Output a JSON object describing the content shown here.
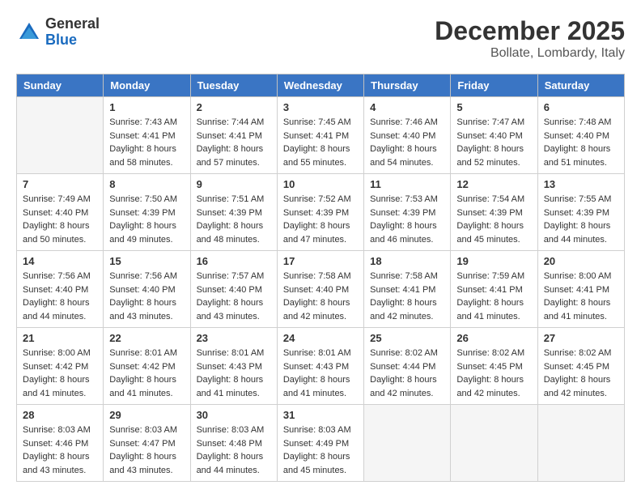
{
  "logo": {
    "general": "General",
    "blue": "Blue"
  },
  "title": "December 2025",
  "location": "Bollate, Lombardy, Italy",
  "weekdays": [
    "Sunday",
    "Monday",
    "Tuesday",
    "Wednesday",
    "Thursday",
    "Friday",
    "Saturday"
  ],
  "days": [
    {
      "date": null,
      "number": "",
      "sunrise": "",
      "sunset": "",
      "daylight": ""
    },
    {
      "date": 1,
      "number": "1",
      "sunrise": "Sunrise: 7:43 AM",
      "sunset": "Sunset: 4:41 PM",
      "daylight": "Daylight: 8 hours and 58 minutes."
    },
    {
      "date": 2,
      "number": "2",
      "sunrise": "Sunrise: 7:44 AM",
      "sunset": "Sunset: 4:41 PM",
      "daylight": "Daylight: 8 hours and 57 minutes."
    },
    {
      "date": 3,
      "number": "3",
      "sunrise": "Sunrise: 7:45 AM",
      "sunset": "Sunset: 4:41 PM",
      "daylight": "Daylight: 8 hours and 55 minutes."
    },
    {
      "date": 4,
      "number": "4",
      "sunrise": "Sunrise: 7:46 AM",
      "sunset": "Sunset: 4:40 PM",
      "daylight": "Daylight: 8 hours and 54 minutes."
    },
    {
      "date": 5,
      "number": "5",
      "sunrise": "Sunrise: 7:47 AM",
      "sunset": "Sunset: 4:40 PM",
      "daylight": "Daylight: 8 hours and 52 minutes."
    },
    {
      "date": 6,
      "number": "6",
      "sunrise": "Sunrise: 7:48 AM",
      "sunset": "Sunset: 4:40 PM",
      "daylight": "Daylight: 8 hours and 51 minutes."
    },
    {
      "date": 7,
      "number": "7",
      "sunrise": "Sunrise: 7:49 AM",
      "sunset": "Sunset: 4:40 PM",
      "daylight": "Daylight: 8 hours and 50 minutes."
    },
    {
      "date": 8,
      "number": "8",
      "sunrise": "Sunrise: 7:50 AM",
      "sunset": "Sunset: 4:39 PM",
      "daylight": "Daylight: 8 hours and 49 minutes."
    },
    {
      "date": 9,
      "number": "9",
      "sunrise": "Sunrise: 7:51 AM",
      "sunset": "Sunset: 4:39 PM",
      "daylight": "Daylight: 8 hours and 48 minutes."
    },
    {
      "date": 10,
      "number": "10",
      "sunrise": "Sunrise: 7:52 AM",
      "sunset": "Sunset: 4:39 PM",
      "daylight": "Daylight: 8 hours and 47 minutes."
    },
    {
      "date": 11,
      "number": "11",
      "sunrise": "Sunrise: 7:53 AM",
      "sunset": "Sunset: 4:39 PM",
      "daylight": "Daylight: 8 hours and 46 minutes."
    },
    {
      "date": 12,
      "number": "12",
      "sunrise": "Sunrise: 7:54 AM",
      "sunset": "Sunset: 4:39 PM",
      "daylight": "Daylight: 8 hours and 45 minutes."
    },
    {
      "date": 13,
      "number": "13",
      "sunrise": "Sunrise: 7:55 AM",
      "sunset": "Sunset: 4:39 PM",
      "daylight": "Daylight: 8 hours and 44 minutes."
    },
    {
      "date": 14,
      "number": "14",
      "sunrise": "Sunrise: 7:56 AM",
      "sunset": "Sunset: 4:40 PM",
      "daylight": "Daylight: 8 hours and 44 minutes."
    },
    {
      "date": 15,
      "number": "15",
      "sunrise": "Sunrise: 7:56 AM",
      "sunset": "Sunset: 4:40 PM",
      "daylight": "Daylight: 8 hours and 43 minutes."
    },
    {
      "date": 16,
      "number": "16",
      "sunrise": "Sunrise: 7:57 AM",
      "sunset": "Sunset: 4:40 PM",
      "daylight": "Daylight: 8 hours and 43 minutes."
    },
    {
      "date": 17,
      "number": "17",
      "sunrise": "Sunrise: 7:58 AM",
      "sunset": "Sunset: 4:40 PM",
      "daylight": "Daylight: 8 hours and 42 minutes."
    },
    {
      "date": 18,
      "number": "18",
      "sunrise": "Sunrise: 7:58 AM",
      "sunset": "Sunset: 4:41 PM",
      "daylight": "Daylight: 8 hours and 42 minutes."
    },
    {
      "date": 19,
      "number": "19",
      "sunrise": "Sunrise: 7:59 AM",
      "sunset": "Sunset: 4:41 PM",
      "daylight": "Daylight: 8 hours and 41 minutes."
    },
    {
      "date": 20,
      "number": "20",
      "sunrise": "Sunrise: 8:00 AM",
      "sunset": "Sunset: 4:41 PM",
      "daylight": "Daylight: 8 hours and 41 minutes."
    },
    {
      "date": 21,
      "number": "21",
      "sunrise": "Sunrise: 8:00 AM",
      "sunset": "Sunset: 4:42 PM",
      "daylight": "Daylight: 8 hours and 41 minutes."
    },
    {
      "date": 22,
      "number": "22",
      "sunrise": "Sunrise: 8:01 AM",
      "sunset": "Sunset: 4:42 PM",
      "daylight": "Daylight: 8 hours and 41 minutes."
    },
    {
      "date": 23,
      "number": "23",
      "sunrise": "Sunrise: 8:01 AM",
      "sunset": "Sunset: 4:43 PM",
      "daylight": "Daylight: 8 hours and 41 minutes."
    },
    {
      "date": 24,
      "number": "24",
      "sunrise": "Sunrise: 8:01 AM",
      "sunset": "Sunset: 4:43 PM",
      "daylight": "Daylight: 8 hours and 41 minutes."
    },
    {
      "date": 25,
      "number": "25",
      "sunrise": "Sunrise: 8:02 AM",
      "sunset": "Sunset: 4:44 PM",
      "daylight": "Daylight: 8 hours and 42 minutes."
    },
    {
      "date": 26,
      "number": "26",
      "sunrise": "Sunrise: 8:02 AM",
      "sunset": "Sunset: 4:45 PM",
      "daylight": "Daylight: 8 hours and 42 minutes."
    },
    {
      "date": 27,
      "number": "27",
      "sunrise": "Sunrise: 8:02 AM",
      "sunset": "Sunset: 4:45 PM",
      "daylight": "Daylight: 8 hours and 42 minutes."
    },
    {
      "date": 28,
      "number": "28",
      "sunrise": "Sunrise: 8:03 AM",
      "sunset": "Sunset: 4:46 PM",
      "daylight": "Daylight: 8 hours and 43 minutes."
    },
    {
      "date": 29,
      "number": "29",
      "sunrise": "Sunrise: 8:03 AM",
      "sunset": "Sunset: 4:47 PM",
      "daylight": "Daylight: 8 hours and 43 minutes."
    },
    {
      "date": 30,
      "number": "30",
      "sunrise": "Sunrise: 8:03 AM",
      "sunset": "Sunset: 4:48 PM",
      "daylight": "Daylight: 8 hours and 44 minutes."
    },
    {
      "date": 31,
      "number": "31",
      "sunrise": "Sunrise: 8:03 AM",
      "sunset": "Sunset: 4:49 PM",
      "daylight": "Daylight: 8 hours and 45 minutes."
    }
  ]
}
